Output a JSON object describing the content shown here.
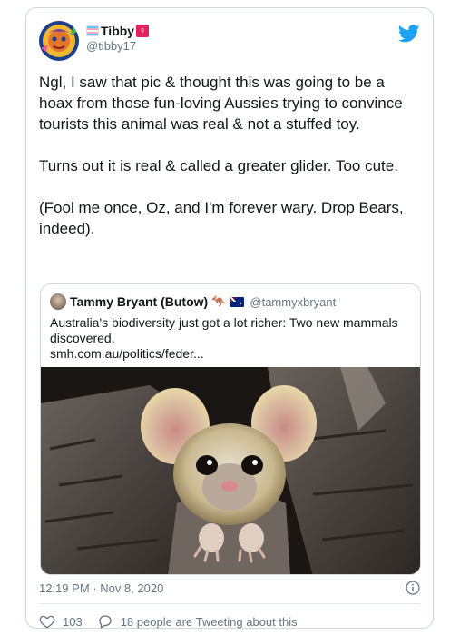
{
  "user": {
    "display_name": "Tibby",
    "handle": "@tibby17"
  },
  "tweet": {
    "text": "Ngl, I saw that pic & thought this was going to be a hoax from those fun-loving Aussies trying to convince tourists this animal was real & not a stuffed toy.\n\nTurns out it is real & called a greater glider. Too cute.\n\n(Fool me once, Oz, and I'm forever wary.  Drop Bears, indeed).",
    "timestamp": "12:19 PM · Nov 8, 2020"
  },
  "quoted": {
    "display_name": "Tammy Bryant (Butow)",
    "handle": "@tammyxbryant",
    "text": "Australia's biodiversity just got a lot richer: Two new mammals discovered.\nsmh.com.au/politics/feder...",
    "image_subject": "greater-glider-photo"
  },
  "actions": {
    "likes": "103",
    "conversation": "18 people are Tweeting about this"
  },
  "colors": {
    "twitter_blue": "#1da1f2",
    "text": "#14171a",
    "muted": "#657786",
    "border": "#cfd9de"
  },
  "icons": [
    "flag-icon",
    "female-sign-icon",
    "twitter-bird-icon",
    "kangaroo-icon",
    "australian-flag-icon",
    "info-icon",
    "heart-icon",
    "reply-icon"
  ]
}
